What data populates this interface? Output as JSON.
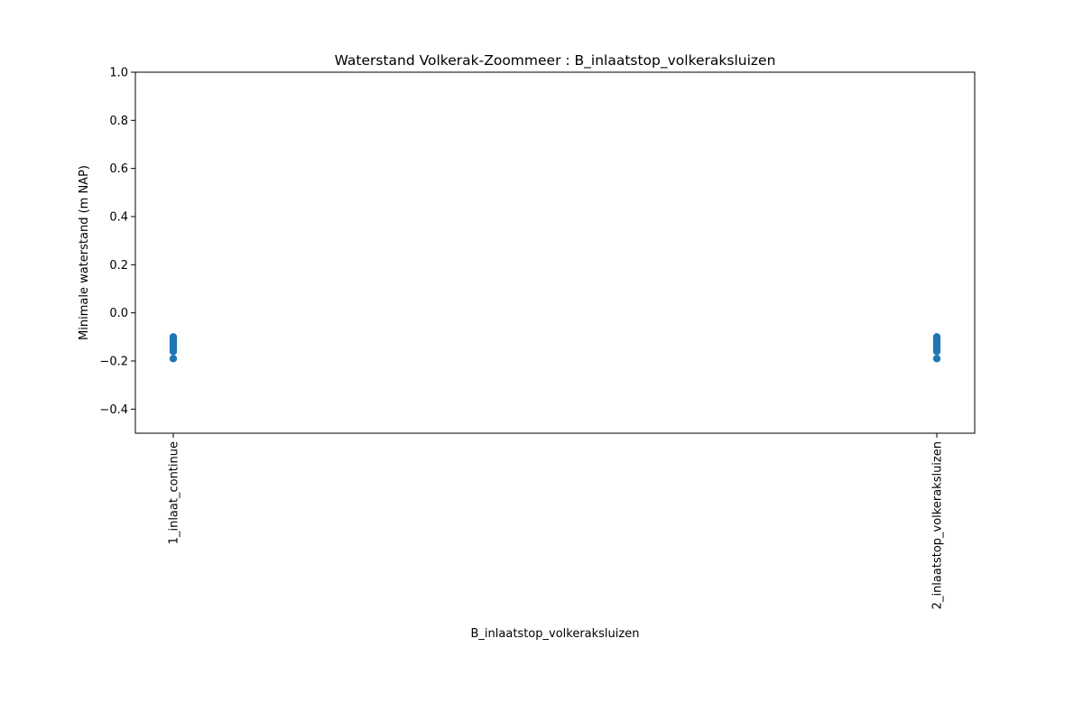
{
  "chart_data": {
    "type": "scatter",
    "title": "Waterstand Volkerak-Zoommeer : B_inlaatstop_volkeraksluizen",
    "xlabel": "B_inlaatstop_volkeraksluizen",
    "ylabel": "Minimale waterstand (m NAP)",
    "categories": [
      "1_inlaat_continue",
      "2_inlaatstop_volkeraksluizen"
    ],
    "ylim": [
      -0.5,
      1.0
    ],
    "yticks": [
      -0.4,
      -0.2,
      0.0,
      0.2,
      0.4,
      0.6,
      0.8,
      1.0
    ],
    "ytick_labels": [
      "−0.4",
      "−0.2",
      "0.0",
      "0.2",
      "0.4",
      "0.6",
      "0.8",
      "1.0"
    ],
    "grid": false,
    "marker_color": "#1f77b4",
    "series": [
      {
        "points": [
          {
            "category": "1_inlaat_continue",
            "y": -0.1
          },
          {
            "category": "1_inlaat_continue",
            "y": -0.11
          },
          {
            "category": "1_inlaat_continue",
            "y": -0.12
          },
          {
            "category": "1_inlaat_continue",
            "y": -0.13
          },
          {
            "category": "1_inlaat_continue",
            "y": -0.14
          },
          {
            "category": "1_inlaat_continue",
            "y": -0.15
          },
          {
            "category": "1_inlaat_continue",
            "y": -0.16
          },
          {
            "category": "1_inlaat_continue",
            "y": -0.19
          },
          {
            "category": "2_inlaatstop_volkeraksluizen",
            "y": -0.1
          },
          {
            "category": "2_inlaatstop_volkeraksluizen",
            "y": -0.11
          },
          {
            "category": "2_inlaatstop_volkeraksluizen",
            "y": -0.12
          },
          {
            "category": "2_inlaatstop_volkeraksluizen",
            "y": -0.13
          },
          {
            "category": "2_inlaatstop_volkeraksluizen",
            "y": -0.14
          },
          {
            "category": "2_inlaatstop_volkeraksluizen",
            "y": -0.15
          },
          {
            "category": "2_inlaatstop_volkeraksluizen",
            "y": -0.16
          },
          {
            "category": "2_inlaatstop_volkeraksluizen",
            "y": -0.19
          }
        ]
      }
    ]
  }
}
